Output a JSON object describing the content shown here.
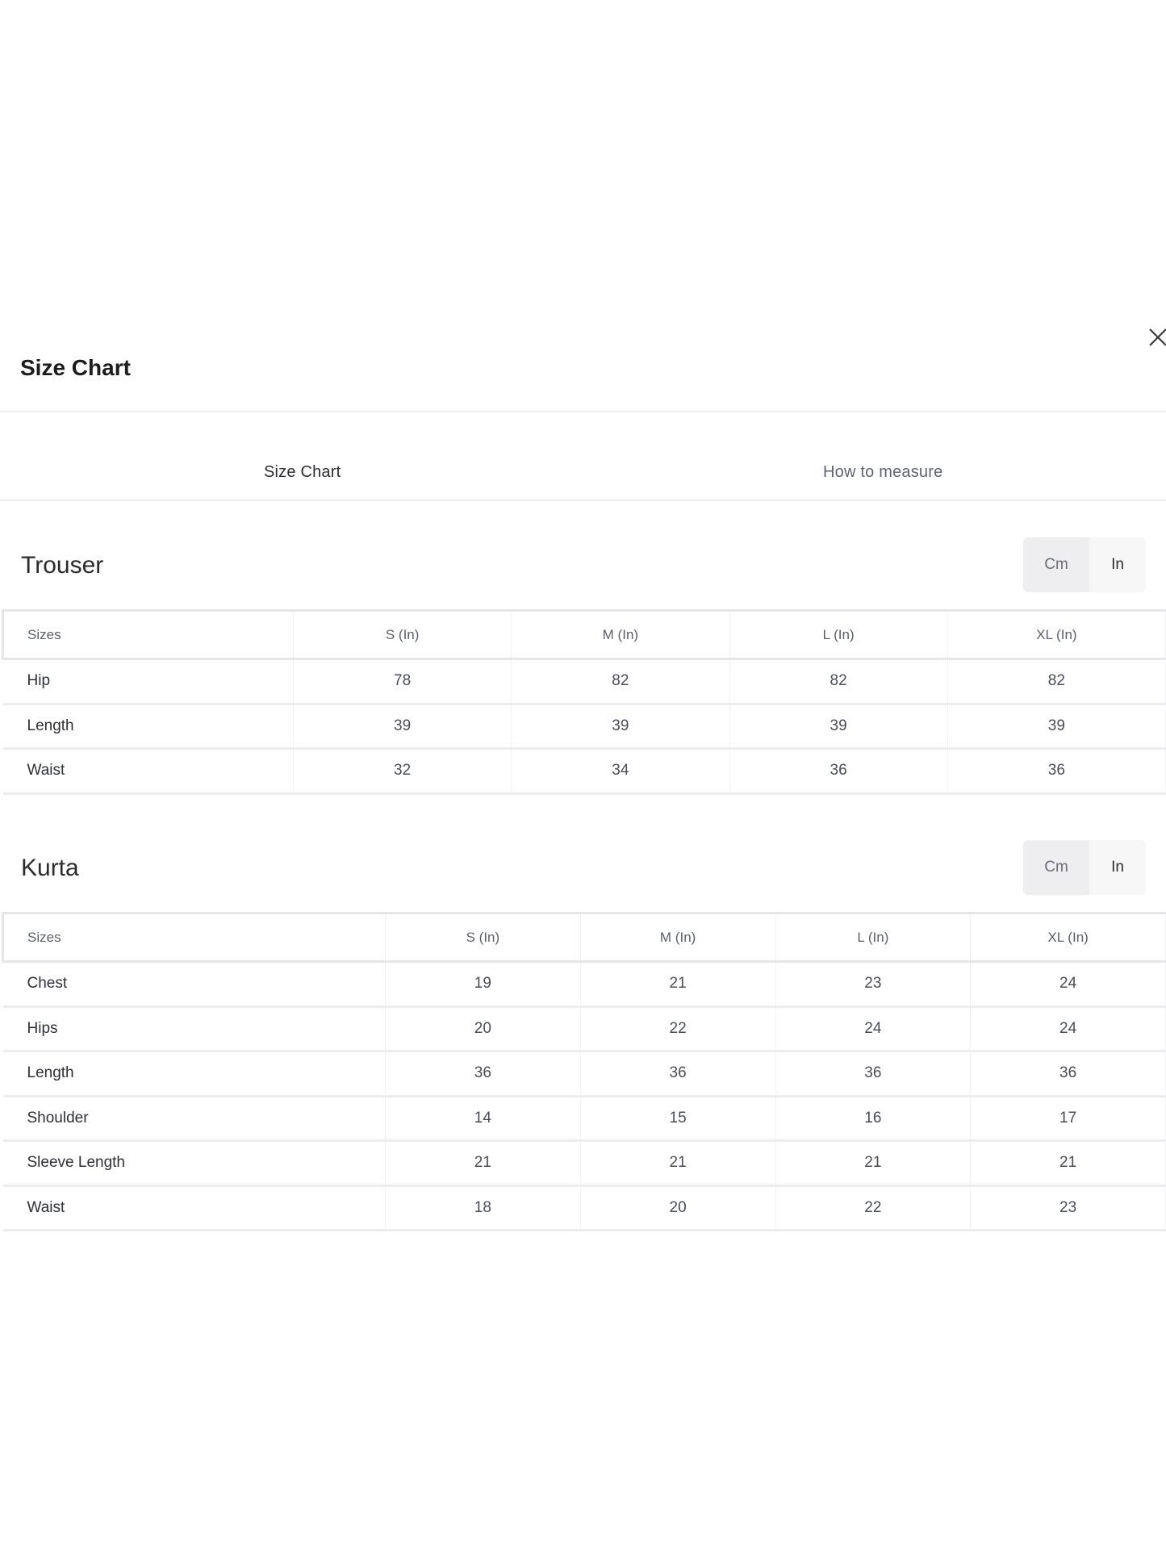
{
  "modal": {
    "title": "Size Chart",
    "close_icon": "close-icon"
  },
  "tabs": [
    {
      "label": "Size Chart",
      "active": true
    },
    {
      "label": "How to measure",
      "active": false
    }
  ],
  "unit_toggle": {
    "cm_label": "Cm",
    "in_label": "In",
    "selected": "In"
  },
  "trouser": {
    "title": "Trouser",
    "headers": [
      "Sizes",
      "S (In)",
      "M (In)",
      "L (In)",
      "XL (In)"
    ],
    "rows": [
      [
        "Hip",
        "78",
        "82",
        "82",
        "82"
      ],
      [
        "Length",
        "39",
        "39",
        "39",
        "39"
      ],
      [
        "Waist",
        "32",
        "34",
        "36",
        "36"
      ]
    ]
  },
  "kurta": {
    "title": "Kurta",
    "headers": [
      "Sizes",
      "S (In)",
      "M (In)",
      "L (In)",
      "XL (In)"
    ],
    "rows": [
      [
        "Chest",
        "19",
        "21",
        "23",
        "24"
      ],
      [
        "Hips",
        "20",
        "22",
        "24",
        "24"
      ],
      [
        "Length",
        "36",
        "36",
        "36",
        "36"
      ],
      [
        "Shoulder",
        "14",
        "15",
        "16",
        "17"
      ],
      [
        "Sleeve Length",
        "21",
        "21",
        "21",
        "21"
      ],
      [
        "Waist",
        "18",
        "20",
        "22",
        "23"
      ]
    ]
  }
}
